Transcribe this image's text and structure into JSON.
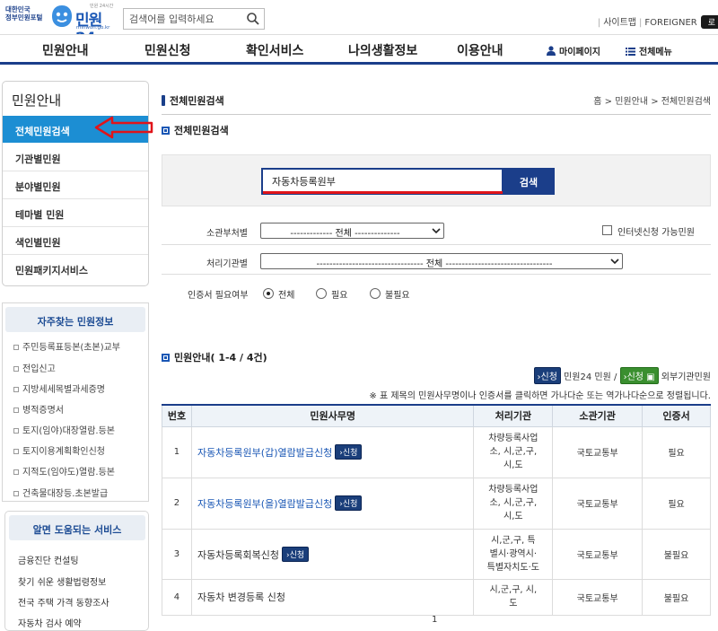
{
  "header": {
    "gov_logo_line1": "대한민국",
    "gov_logo_line2": "정부민원포털",
    "logo_text": "민원24",
    "logo_sub": "minwon.go.kr",
    "logo_tag": "민원 24시간",
    "search_placeholder": "검색어를 입력하세요",
    "sitemap": "사이트맵",
    "foreigner": "FOREIGNER",
    "lang_tab": "로"
  },
  "gnb": {
    "items": [
      "민원안내",
      "민원신청",
      "확인서비스",
      "나의생활정보",
      "이용안내"
    ],
    "mypage": "마이페이지",
    "allmenu": "전체메뉴"
  },
  "lnb": {
    "title": "민원안내",
    "items": [
      "전체민원검색",
      "기관별민원",
      "분야별민원",
      "테마별 민원",
      "색인별민원",
      "민원패키지서비스"
    ]
  },
  "faq": {
    "title": "자주찾는 민원정보",
    "items": [
      "주민등록표등본(초본)교부",
      "전입신고",
      "지방세세목별과세증명",
      "병적증명서",
      "토지(임야)대장열람.등본",
      "토지이용계획확인신청",
      "지적도(임야도)열람.등본",
      "건축물대장등.초본발급"
    ]
  },
  "help": {
    "title": "알면 도움되는 서비스",
    "items": [
      "금융진단 컨설팅",
      "찾기 쉬운 생활법령정보",
      "전국 주택 가격 동향조사",
      "자동차 검사 예약"
    ]
  },
  "main": {
    "page_title": "전체민원검색",
    "breadcrumb_home": "홈",
    "breadcrumb_mid": "민원안내",
    "breadcrumb_cur": "전체민원검색",
    "section_title": "전체민원검색",
    "keyword": "자동차등록원부",
    "search_button": "검색",
    "dept_label": "소관부처별",
    "dept_value": "------------- 전체 --------------",
    "online_label": "인터넷신청 가능민원",
    "agency_label": "처리기관별",
    "agency_value": "--------------------------------- 전체 ---------------------------------",
    "cert_label": "인증서 필요여부",
    "cert_options": [
      "전체",
      "필요",
      "불필요"
    ],
    "result_title": "민원안내( 1-4 / 4건)",
    "legend_apply": "신청",
    "legend_apply_text": "민원24 민원 /",
    "legend_ext": "신청",
    "legend_ext_text": "외부기관민원",
    "sort_note": "※ 표 제목의 민원사무명이나 인증서를 클릭하면 가나다순 또는 역가나다순으로 정렬됩니다.",
    "pager": "1"
  },
  "table": {
    "headers": [
      "번호",
      "민원사무명",
      "처리기관",
      "소관기관",
      "인증서"
    ],
    "rows": [
      {
        "no": "1",
        "name_hl": "자동차등록원부",
        "name_rest": "(갑)열람발급신청",
        "apply": "신청",
        "org1": "차량등록사업",
        "org2": "소, 시,군,구,",
        "org3": "시,도",
        "dept": "국토교통부",
        "cert": "필요"
      },
      {
        "no": "2",
        "name_hl": "자동차등록원부",
        "name_rest": "(을)열람발급신청",
        "apply": "신청",
        "org1": "차량등록사업",
        "org2": "소, 시,군,구,",
        "org3": "시,도",
        "dept": "국토교통부",
        "cert": "필요"
      },
      {
        "no": "3",
        "name_hl": "",
        "name_rest": "자동차등록회복신청",
        "apply": "신청",
        "org1": "시,군,구, 특",
        "org2": "별시·광역시·",
        "org3": "특별자치도·도",
        "dept": "국토교통부",
        "cert": "불필요"
      },
      {
        "no": "4",
        "name_hl": "",
        "name_rest": "자동차 변경등록 신청",
        "apply": "",
        "org1": "시,군,구, 시,",
        "org2": "도",
        "org3": "",
        "dept": "국토교통부",
        "cert": "불필요"
      }
    ]
  },
  "colors": {
    "navy": "#1b3e8a",
    "active_blue": "#1c8ed3",
    "highlight_red": "#e0141a",
    "link_blue": "#1a57b5"
  }
}
